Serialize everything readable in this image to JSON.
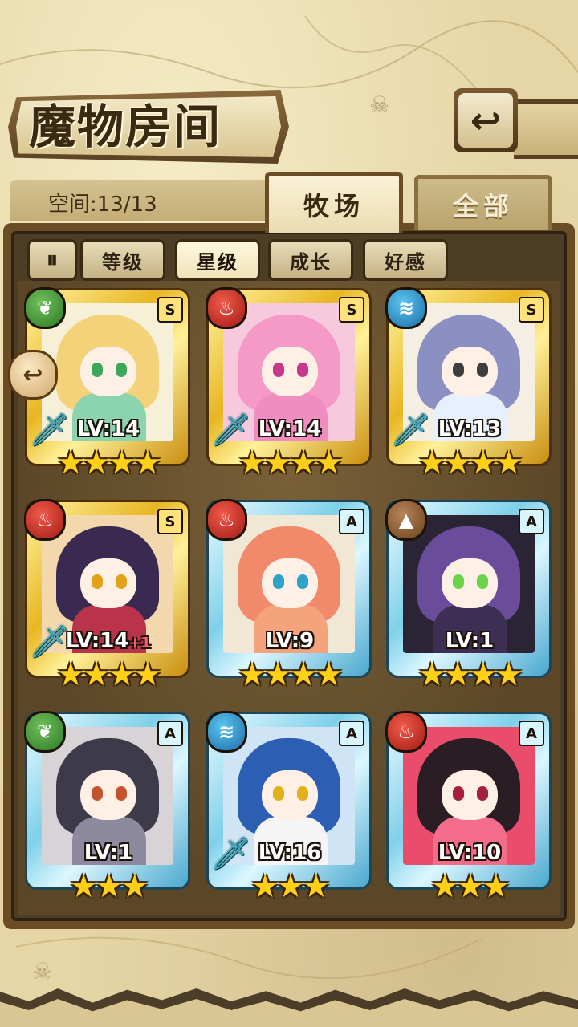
{
  "header": {
    "title": "魔物房间",
    "back_icon": "↩"
  },
  "space": {
    "label": "空间:13/13"
  },
  "tabs": [
    {
      "label": "牧场",
      "active": true
    },
    {
      "label": "全部",
      "active": false
    }
  ],
  "filters": {
    "toggle_icon": "⏸",
    "buttons": [
      {
        "label": "等级",
        "active": false
      },
      {
        "label": "星级",
        "active": true
      },
      {
        "label": "成长",
        "active": false
      },
      {
        "label": "好感",
        "active": false
      }
    ]
  },
  "side_arrow_icon": "↩",
  "monsters": [
    {
      "frame": "gold",
      "rank": "S",
      "element": "leaf",
      "level": "LV:14",
      "plus": "",
      "stars": "★★★★",
      "sword": true,
      "colors": {
        "bg": "#f6f0d8",
        "hair": "#f3d27a",
        "eye": "#3ba85a",
        "body": "#8cd3b0"
      }
    },
    {
      "frame": "gold",
      "rank": "S",
      "element": "fire",
      "level": "LV:14",
      "plus": "",
      "stars": "★★★★",
      "sword": true,
      "colors": {
        "bg": "#f7c9dc",
        "hair": "#f59ac6",
        "eye": "#c9378a",
        "body": "#ef8cc0"
      }
    },
    {
      "frame": "gold",
      "rank": "S",
      "element": "water",
      "level": "LV:13",
      "plus": "",
      "stars": "★★★★",
      "sword": true,
      "colors": {
        "bg": "#f5efe3",
        "hair": "#8b8fc2",
        "eye": "#3e3e3e",
        "body": "#e7f0ff"
      }
    },
    {
      "frame": "gold",
      "rank": "S",
      "element": "fire",
      "level": "LV:14",
      "plus": "+1",
      "stars": "★★★★",
      "sword": true,
      "colors": {
        "bg": "#f3d7ad",
        "hair": "#3a2950",
        "eye": "#e2a21a",
        "body": "#b9344a"
      }
    },
    {
      "frame": "blue",
      "rank": "A",
      "element": "fire",
      "level": "LV:9",
      "plus": "",
      "stars": "★★★★",
      "sword": false,
      "colors": {
        "bg": "#f1e7d5",
        "hair": "#f08a6a",
        "eye": "#2ea3c8",
        "body": "#f4a37c"
      }
    },
    {
      "frame": "blue",
      "rank": "A",
      "element": "earth",
      "level": "LV:1",
      "plus": "",
      "stars": "★★★★",
      "sword": false,
      "colors": {
        "bg": "#2a2435",
        "hair": "#6a4c9b",
        "eye": "#6bd34a",
        "body": "#3d2f54"
      }
    },
    {
      "frame": "blue",
      "rank": "A",
      "element": "leaf",
      "level": "LV:1",
      "plus": "",
      "stars": "★★★",
      "sword": false,
      "colors": {
        "bg": "#d8d3d6",
        "hair": "#3d3a4a",
        "eye": "#c4532f",
        "body": "#8d8aa0"
      }
    },
    {
      "frame": "blue",
      "rank": "A",
      "element": "water",
      "level": "LV:16",
      "plus": "",
      "stars": "★★★",
      "sword": true,
      "colors": {
        "bg": "#cfe4f4",
        "hair": "#2c5fb4",
        "eye": "#e3b21a",
        "body": "#f5f5f5"
      }
    },
    {
      "frame": "blue",
      "rank": "A",
      "element": "fire",
      "level": "LV:10",
      "plus": "",
      "stars": "★★★",
      "sword": false,
      "colors": {
        "bg": "#e94d6b",
        "hair": "#2a1e24",
        "eye": "#a32040",
        "body": "#f36d8a"
      }
    }
  ],
  "element_icons": {
    "leaf": "❦",
    "fire": "♨",
    "water": "≋",
    "earth": "▲"
  }
}
